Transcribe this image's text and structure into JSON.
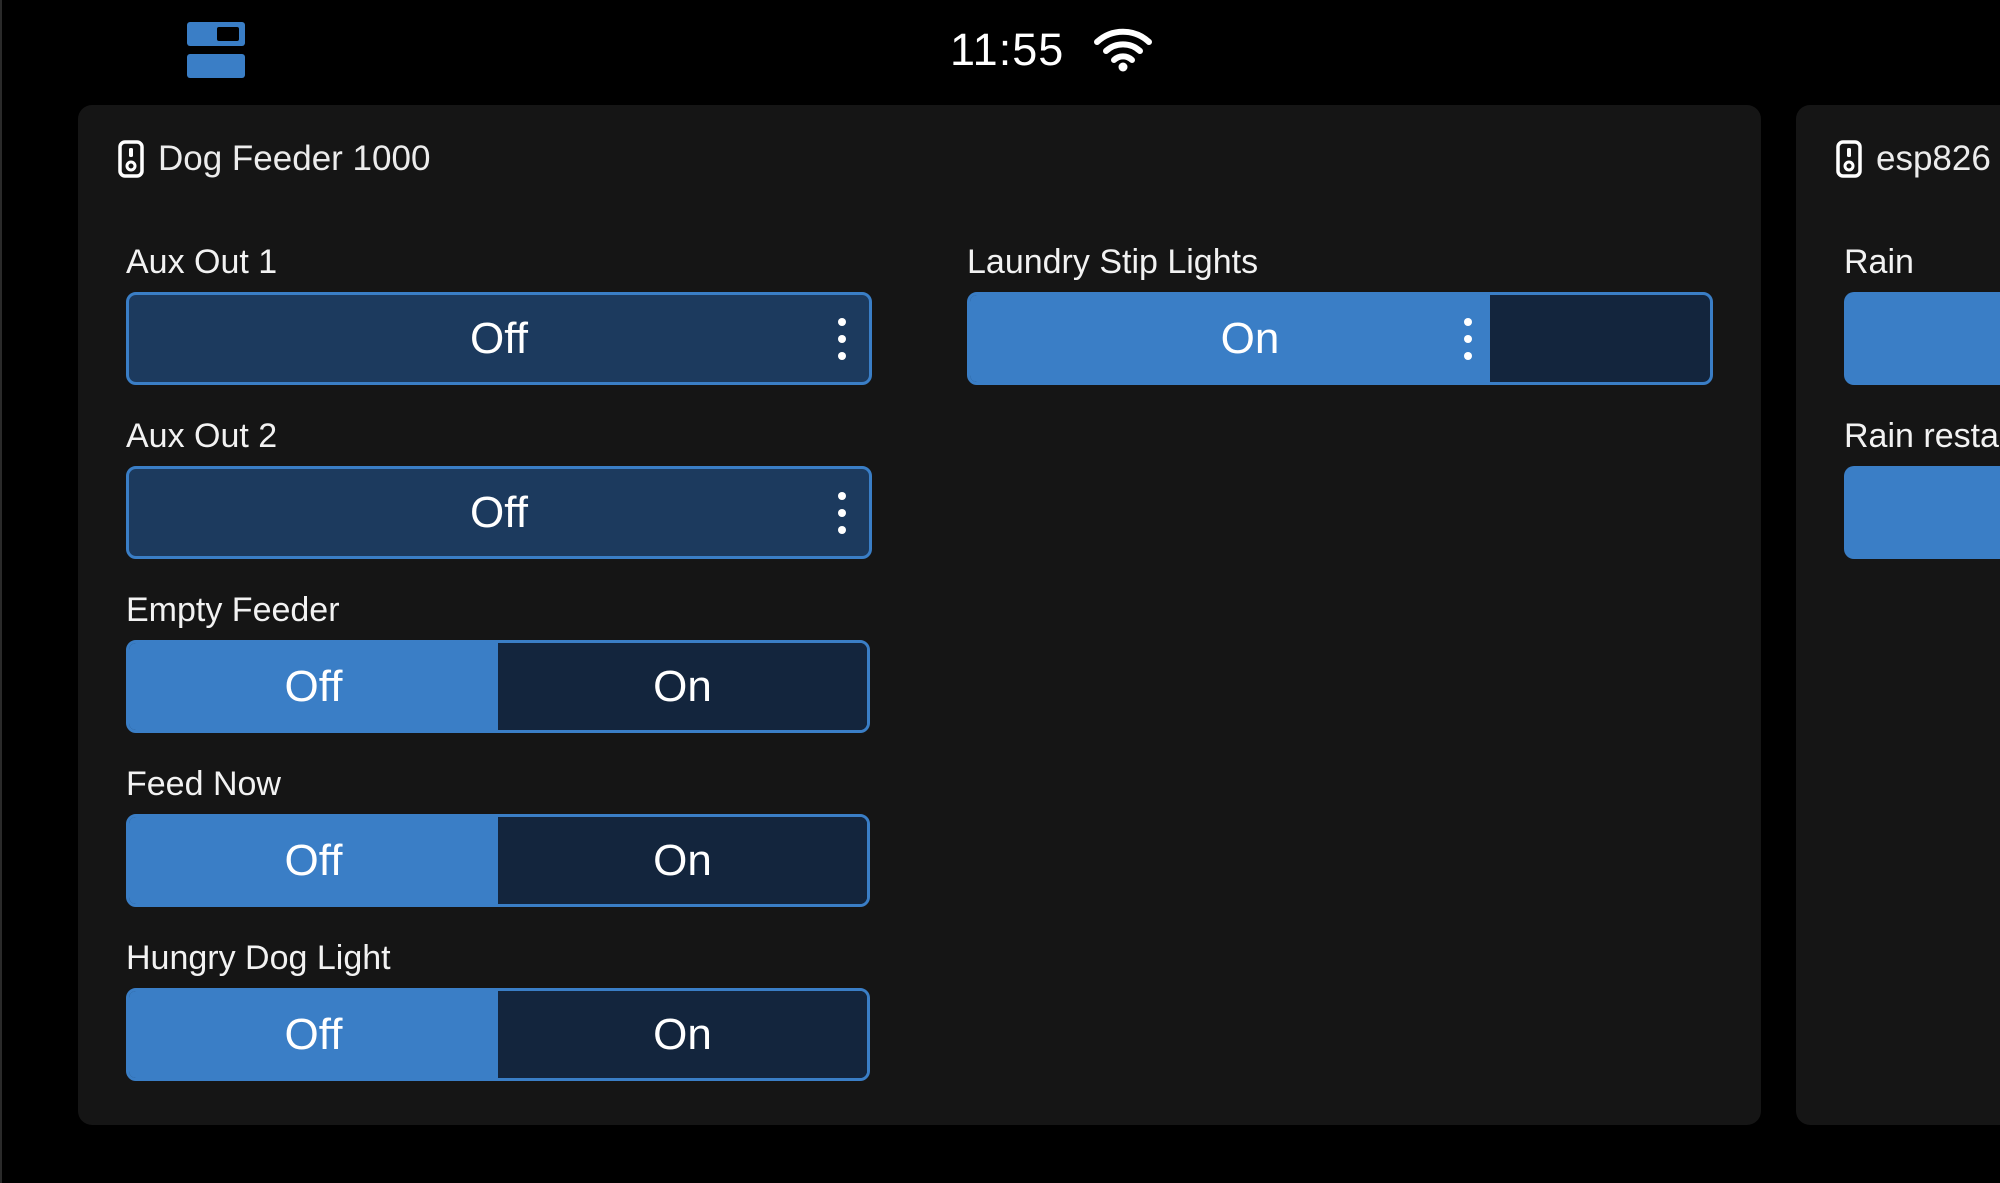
{
  "status_bar": {
    "time": "11:55",
    "layout_icon": "layout-toggle-icon",
    "wifi_icon": "wifi-icon"
  },
  "colors": {
    "background": "#000000",
    "card": "#151515",
    "accent": "#3a7ec6",
    "button_dark": "#1c3a5e",
    "segment_dark": "#13253d"
  },
  "main_card": {
    "title": "Dog Feeder 1000",
    "icon": "device-remote-icon",
    "left_column": [
      {
        "label": "Aux Out 1",
        "type": "button",
        "value": "Off"
      },
      {
        "label": "Aux Out 2",
        "type": "button",
        "value": "Off"
      },
      {
        "label": "Empty Feeder",
        "type": "toggle",
        "off": "Off",
        "on": "On",
        "active": "Off"
      },
      {
        "label": "Feed Now",
        "type": "toggle",
        "off": "Off",
        "on": "On",
        "active": "Off"
      },
      {
        "label": "Hungry Dog Light",
        "type": "toggle",
        "off": "Off",
        "on": "On",
        "active": "Off"
      }
    ],
    "right_column": [
      {
        "label": "Laundry Stip Lights",
        "type": "split-button",
        "value": "On"
      }
    ]
  },
  "side_card": {
    "title": "esp826",
    "icon": "device-remote-icon",
    "items": [
      {
        "label": "Rain"
      },
      {
        "label": "Rain resta"
      }
    ]
  }
}
